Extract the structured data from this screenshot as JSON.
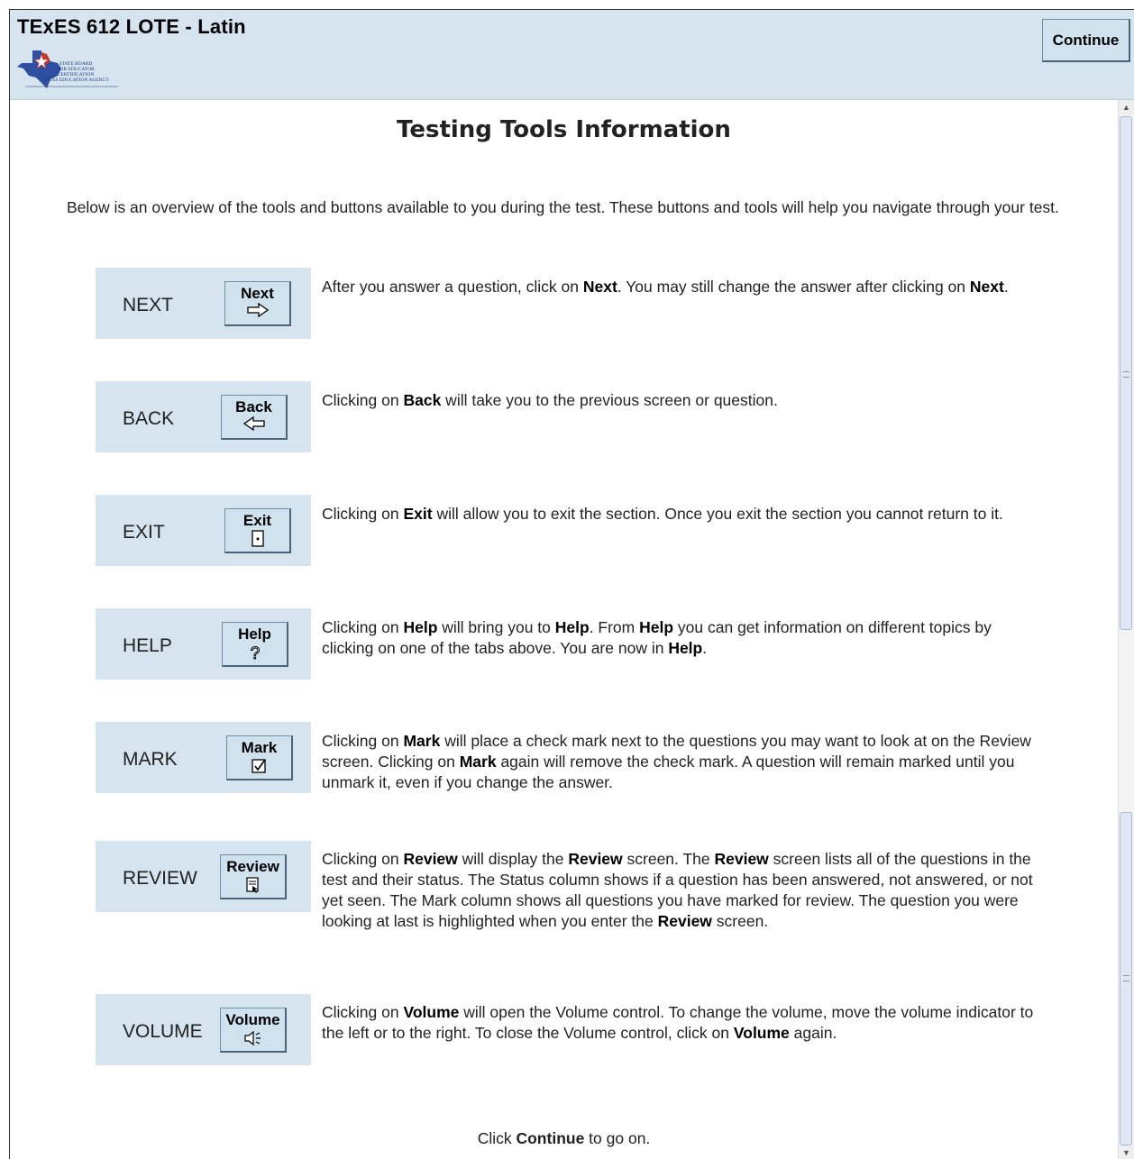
{
  "header": {
    "title": "TExES 612 LOTE - Latin",
    "continue_label": "Continue",
    "logo_lines": [
      "STATE BOARD",
      "FOR EDUCATOR",
      "CERTIFICATION",
      "TEXAS EDUCATION AGENCY"
    ]
  },
  "page": {
    "title": "Testing Tools Information",
    "intro": "Below is an overview of the tools and buttons available to you during the test.  These buttons and tools will help you navigate through your test.",
    "footer": {
      "pre": "Click ",
      "bold": "Continue",
      "post": " to go on."
    }
  },
  "tools": [
    {
      "label": "NEXT",
      "button": "Next",
      "icon": "right-arrow-icon",
      "desc": [
        [
          "After you answer a question, click on ",
          false
        ],
        [
          "Next",
          true
        ],
        [
          ".  You may still change the answer after clicking on ",
          false
        ],
        [
          "Next",
          true
        ],
        [
          ".",
          false
        ]
      ]
    },
    {
      "label": "BACK",
      "button": "Back",
      "icon": "left-arrow-icon",
      "desc": [
        [
          "Clicking on ",
          false
        ],
        [
          "Back",
          true
        ],
        [
          " will take you to the previous screen or question.",
          false
        ]
      ]
    },
    {
      "label": "EXIT",
      "button": "Exit",
      "icon": "door-icon",
      "desc": [
        [
          "Clicking on ",
          false
        ],
        [
          "Exit",
          true
        ],
        [
          " will allow you to exit the section.  Once you exit the section you cannot return to it.",
          false
        ]
      ]
    },
    {
      "label": "HELP",
      "button": "Help",
      "icon": "question-icon",
      "desc": [
        [
          "Clicking on ",
          false
        ],
        [
          "Help",
          true
        ],
        [
          " will bring you to ",
          false
        ],
        [
          "Help",
          true
        ],
        [
          ".  From ",
          false
        ],
        [
          "Help",
          true
        ],
        [
          " you can get information on different topics by clicking on one of the tabs above.  You are now in ",
          false
        ],
        [
          "Help",
          true
        ],
        [
          ".",
          false
        ]
      ]
    },
    {
      "label": "MARK",
      "button": "Mark",
      "icon": "checkbox-icon",
      "desc": [
        [
          "Clicking on ",
          false
        ],
        [
          "Mark",
          true
        ],
        [
          " will place a check mark next to the questions you may want to look at on the Review screen. Clicking on ",
          false
        ],
        [
          "Mark",
          true
        ],
        [
          " again will remove the check mark. A question will remain marked until you unmark it, even if you change the answer.",
          false
        ]
      ]
    },
    {
      "label": "REVIEW",
      "button": "Review",
      "icon": "review-icon",
      "desc": [
        [
          "Clicking on ",
          false
        ],
        [
          "Review",
          true
        ],
        [
          " will display the ",
          false
        ],
        [
          "Review",
          true
        ],
        [
          " screen. The ",
          false
        ],
        [
          "Review",
          true
        ],
        [
          " screen lists all of the questions in the test and their status. The Status column shows if a question has been answered, not answered, or not yet seen. The Mark column shows all questions you have marked for review. The question you were looking at last is highlighted when you enter the ",
          false
        ],
        [
          "Review",
          true
        ],
        [
          " screen.",
          false
        ]
      ]
    },
    {
      "label": "VOLUME",
      "button": "Volume",
      "icon": "speaker-icon",
      "desc": [
        [
          "Clicking on ",
          false
        ],
        [
          "Volume",
          true
        ],
        [
          " will open the Volume control.  To change the volume, move the volume indicator to the left or to the right. To close the Volume control, click on ",
          false
        ],
        [
          "Volume",
          true
        ],
        [
          " again.",
          false
        ]
      ]
    }
  ]
}
